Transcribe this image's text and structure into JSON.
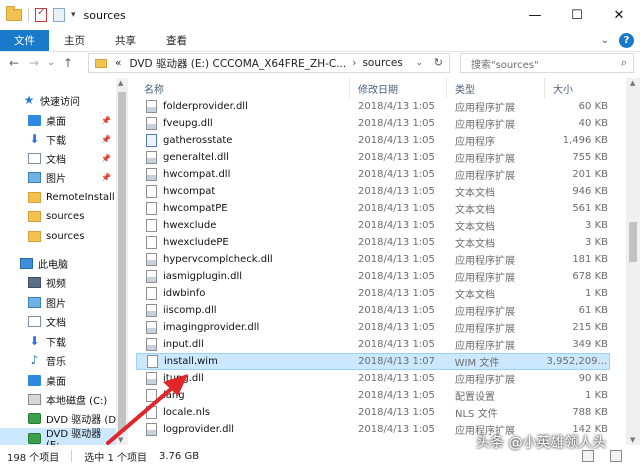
{
  "window": {
    "title": "sources",
    "qa_dropdown": "▾",
    "controls": {
      "minimize": "—",
      "maximize": "☐",
      "close": "✕"
    }
  },
  "ribbon": {
    "tabs": [
      "文件",
      "主页",
      "共享",
      "查看"
    ],
    "expand": "⌄",
    "help": "?"
  },
  "nav_buttons": {
    "back": "←",
    "forward": "→",
    "recent": "⌄",
    "up": "↑"
  },
  "address": {
    "prefix": "«",
    "segments": [
      "DVD 驱动器 (E:) CCCOMA_X64FRE_ZH-C...",
      "sources"
    ],
    "separator": "›",
    "dropdown": "⌄",
    "refresh": "↻"
  },
  "search": {
    "placeholder": "搜索\"sources\"",
    "icon": "⌕"
  },
  "nav_pane": {
    "items": [
      {
        "label": "快速访问",
        "icon": "star-icon",
        "pinned": false
      },
      {
        "label": "桌面",
        "icon": "desktop-icon",
        "pinned": true
      },
      {
        "label": "下载",
        "icon": "download-icon",
        "pinned": true
      },
      {
        "label": "文档",
        "icon": "document-icon",
        "pinned": true
      },
      {
        "label": "图片",
        "icon": "picture-icon",
        "pinned": true
      },
      {
        "label": "RemoteInstall",
        "icon": "folder-icon",
        "pinned": false
      },
      {
        "label": "sources",
        "icon": "folder-icon",
        "pinned": false
      },
      {
        "label": "sources",
        "icon": "folder-icon",
        "pinned": false
      },
      {
        "label": "此电脑",
        "icon": "computer-icon",
        "pinned": false
      },
      {
        "label": "视频",
        "icon": "video-icon",
        "pinned": false
      },
      {
        "label": "图片",
        "icon": "picture-icon",
        "pinned": false
      },
      {
        "label": "文档",
        "icon": "document-icon",
        "pinned": false
      },
      {
        "label": "下载",
        "icon": "download-icon",
        "pinned": false
      },
      {
        "label": "音乐",
        "icon": "music-icon",
        "pinned": false
      },
      {
        "label": "桌面",
        "icon": "desktop-icon",
        "pinned": false
      },
      {
        "label": "本地磁盘 (C:)",
        "icon": "drive-icon",
        "pinned": false
      },
      {
        "label": "DVD 驱动器 (D:",
        "icon": "dvd-icon",
        "pinned": false
      },
      {
        "label": "DVD 驱动器 (E:",
        "icon": "dvd-icon",
        "pinned": false
      }
    ],
    "pin_glyph": "📌",
    "expand_glyph": "⌄"
  },
  "columns": {
    "name": "名称",
    "date": "修改日期",
    "type": "类型",
    "size": "大小",
    "sort_indicator": "^"
  },
  "files": [
    {
      "name": "folderprovider.dll",
      "date": "2018/4/13 1:05",
      "type": "应用程序扩展",
      "size": "60 KB",
      "kind": "dll"
    },
    {
      "name": "fveupg.dll",
      "date": "2018/4/13 1:05",
      "type": "应用程序扩展",
      "size": "40 KB",
      "kind": "dll"
    },
    {
      "name": "gatherosstate",
      "date": "2018/4/13 1:05",
      "type": "应用程序",
      "size": "1,496 KB",
      "kind": "app"
    },
    {
      "name": "generaltel.dll",
      "date": "2018/4/13 1:05",
      "type": "应用程序扩展",
      "size": "755 KB",
      "kind": "dll"
    },
    {
      "name": "hwcompat.dll",
      "date": "2018/4/13 1:05",
      "type": "应用程序扩展",
      "size": "201 KB",
      "kind": "dll"
    },
    {
      "name": "hwcompat",
      "date": "2018/4/13 1:05",
      "type": "文本文档",
      "size": "946 KB",
      "kind": "txt"
    },
    {
      "name": "hwcompatPE",
      "date": "2018/4/13 1:05",
      "type": "文本文档",
      "size": "561 KB",
      "kind": "txt"
    },
    {
      "name": "hwexclude",
      "date": "2018/4/13 1:05",
      "type": "文本文档",
      "size": "3 KB",
      "kind": "txt"
    },
    {
      "name": "hwexcludePE",
      "date": "2018/4/13 1:05",
      "type": "文本文档",
      "size": "3 KB",
      "kind": "txt"
    },
    {
      "name": "hypervcomplcheck.dll",
      "date": "2018/4/13 1:05",
      "type": "应用程序扩展",
      "size": "181 KB",
      "kind": "dll"
    },
    {
      "name": "iasmigplugin.dll",
      "date": "2018/4/13 1:05",
      "type": "应用程序扩展",
      "size": "678 KB",
      "kind": "dll"
    },
    {
      "name": "idwbinfo",
      "date": "2018/4/13 1:05",
      "type": "文本文档",
      "size": "1 KB",
      "kind": "txt"
    },
    {
      "name": "iiscomp.dll",
      "date": "2018/4/13 1:05",
      "type": "应用程序扩展",
      "size": "61 KB",
      "kind": "dll"
    },
    {
      "name": "imagingprovider.dll",
      "date": "2018/4/13 1:05",
      "type": "应用程序扩展",
      "size": "215 KB",
      "kind": "dll"
    },
    {
      "name": "input.dll",
      "date": "2018/4/13 1:05",
      "type": "应用程序扩展",
      "size": "349 KB",
      "kind": "dll"
    },
    {
      "name": "install.wim",
      "date": "2018/4/13 1:07",
      "type": "WIM 文件",
      "size": "3,952,209...",
      "kind": "wim",
      "selected": true
    },
    {
      "name": "itupg.dll",
      "date": "2018/4/13 1:05",
      "type": "应用程序扩展",
      "size": "90 KB",
      "kind": "dll"
    },
    {
      "name": "lang",
      "date": "2018/4/13 1:05",
      "type": "配置设置",
      "size": "1 KB",
      "kind": "ini"
    },
    {
      "name": "locale.nls",
      "date": "2018/4/13 1:05",
      "type": "NLS 文件",
      "size": "788 KB",
      "kind": "nls"
    },
    {
      "name": "logprovider.dll",
      "date": "2018/4/13 1:05",
      "type": "应用程序扩展",
      "size": "142 KB",
      "kind": "dll"
    }
  ],
  "status": {
    "count": "198 个项目",
    "selected": "选中 1 个项目",
    "size": "3.76 GB"
  },
  "watermark": "头条 @小英雄领人头",
  "colors": {
    "accent": "#1979ca",
    "selection": "#cce8ff",
    "arrow": "#e0262b"
  }
}
